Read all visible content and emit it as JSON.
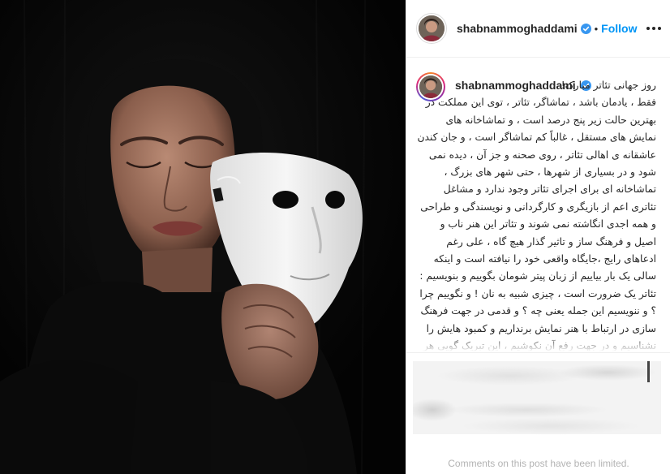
{
  "post": {
    "username": "shabnammoghaddami",
    "follow_label": "Follow",
    "separator": "•",
    "verified_color": "#3897f0",
    "follow_color": "#0095f6",
    "more_icon": "more-horizontal-icon",
    "verified_icon": "verified-badge-icon"
  },
  "caption": {
    "username": "shabnammoghaddami",
    "text": "روز جهانی تئاتر مبارک!\nفقط ، یادمان باشد ، تماشاگر، تئاتر ، توی این مملکت در بهترین حالت زیر پنج درصد است ، و تماشاخانه های نمایش های مستقل ، غالباً کم تماشاگر است ، و جان کندن عاشقانه ی اهالی تئاتر ، روی صحنه و جز آن ، دیده نمی شود و در بسیاری از شهرها ، حتی شهر های بزرگ ، تماشاخانه ای برای اجرای تئاتر وجود ندارد و مشاغل تئاتری اعم از بازیگری و کارگردانی و نویسندگی و طراحی و همه اجدی انگاشته نمی شوند و تئاتر این هنر ناب و اصیل و فرهنگ ساز و تاثیر گذار هیچ گاه ، علی رغم ادعاهای رایج ،جایگاه واقعی خود را نیافته است و اینکه سالی یک بار بیاییم از زبان پیتر شومان بگوییم و بنویسیم : تئاتر یک ضرورت است ، چیزی شبیه به نان ! و نگوییم چرا ؟ و ننویسیم این جمله یعنی چه ؟ و قدمی در جهت فرهنگ سازی در ارتباط با هنر نمایش برنداریم و کمبود هایش را نشناسیم و در جهت رفع آن نکوشیم ، این تبریک گویی هر ساله شبه"
  },
  "comments": {
    "limited_text": "Comments on this post have been limited."
  },
  "photo": {
    "subject": "woman-holding-white-mask",
    "background_color": "#050505",
    "mask_color": "#f2f2f2"
  }
}
